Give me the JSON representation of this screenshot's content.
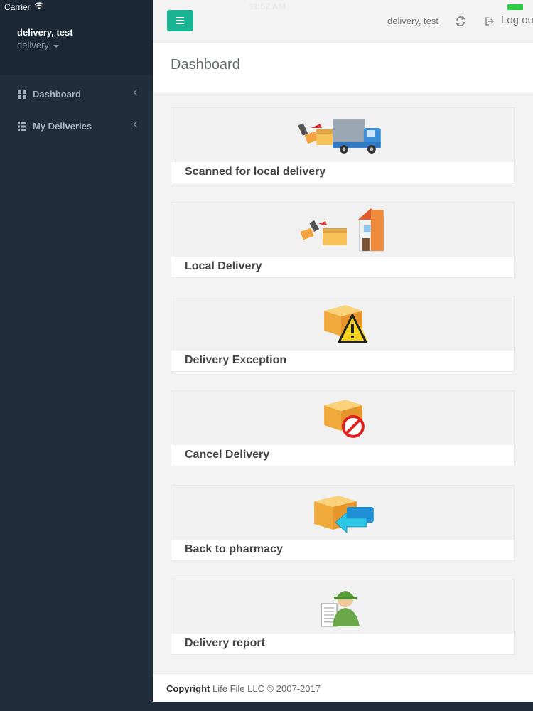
{
  "status": {
    "carrier": "Carrier",
    "time": "11:52 AM"
  },
  "sidebar": {
    "user_name": "delivery, test",
    "role": "delivery",
    "items": [
      {
        "label": "Dashboard",
        "icon": "grid-icon"
      },
      {
        "label": "My Deliveries",
        "icon": "list-icon"
      }
    ]
  },
  "header": {
    "user": "delivery, test",
    "logout_label": "Log out"
  },
  "page": {
    "title": "Dashboard"
  },
  "tiles": [
    {
      "label": "Scanned for local delivery",
      "icon": "scanner-truck-icon"
    },
    {
      "label": "Local Delivery",
      "icon": "scanner-house-icon"
    },
    {
      "label": "Delivery Exception",
      "icon": "package-warning-icon"
    },
    {
      "label": "Cancel Delivery",
      "icon": "package-cancel-icon"
    },
    {
      "label": "Back to pharmacy",
      "icon": "package-return-icon"
    },
    {
      "label": "Delivery report",
      "icon": "delivery-person-report-icon"
    }
  ],
  "footer": {
    "copyright_label": "Copyright",
    "company": "Life File LLC © 2007-2017"
  },
  "colors": {
    "sidebar": "#1f2d3d",
    "accent": "#1ab394",
    "battery": "#2ecc40"
  }
}
